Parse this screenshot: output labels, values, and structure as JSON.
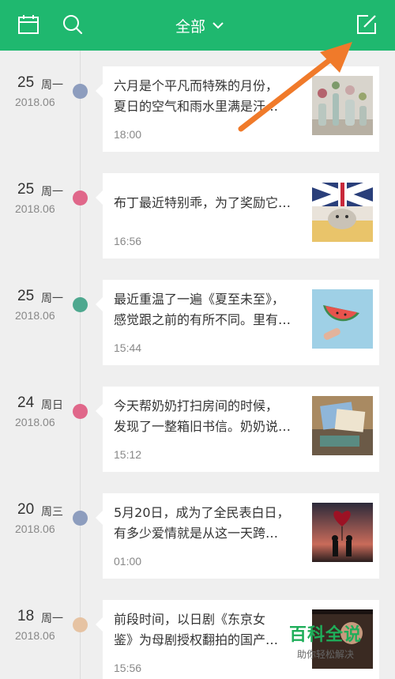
{
  "header": {
    "filter_label": "全部",
    "background": "#1fb86f",
    "icons": [
      "calendar-icon",
      "search-icon",
      "chevron-down-icon",
      "edit-icon"
    ]
  },
  "entries": [
    {
      "day": "25",
      "weekday": "周一",
      "date": "2018.06",
      "dot_color": "#8d9dbe",
      "snippet": "六月是个平凡而特殊的月份，\n夏日的空气和雨水里满是汗…",
      "time": "18:00",
      "thumb": "vases-photo"
    },
    {
      "day": "25",
      "weekday": "周一",
      "date": "2018.06",
      "dot_color": "#e0678a",
      "snippet": "布丁最近特别乖，为了奖励它…",
      "time": "16:56",
      "thumb": "cat-photo"
    },
    {
      "day": "25",
      "weekday": "周一",
      "date": "2018.06",
      "dot_color": "#4ea88f",
      "snippet": "最近重温了一遍《夏至未至》，\n感觉跟之前的有所不同。里有…",
      "time": "15:44",
      "thumb": "watermelon-photo"
    },
    {
      "day": "24",
      "weekday": "周日",
      "date": "2018.06",
      "dot_color": "#e0678a",
      "snippet": "今天帮奶奶打扫房间的时候，\n发现了一整箱旧书信。奶奶说…",
      "time": "15:12",
      "thumb": "letters-photo"
    },
    {
      "day": "20",
      "weekday": "周三",
      "date": "2018.06",
      "dot_color": "#8d9dbe",
      "snippet": "5月20日，成为了全民表白日，\n有多少爱情就是从这一天跨…",
      "time": "01:00",
      "thumb": "heart-balloon-photo"
    },
    {
      "day": "18",
      "weekday": "周一",
      "date": "2018.06",
      "dot_color": "#e6c3a3",
      "snippet": "前段时间，以日剧《东京女\n鉴》为母剧授权翻拍的国产…",
      "time": "15:56",
      "thumb": "drama-photo"
    }
  ],
  "watermark": {
    "title": "百科全说",
    "subtitle": "助你轻松解决"
  }
}
